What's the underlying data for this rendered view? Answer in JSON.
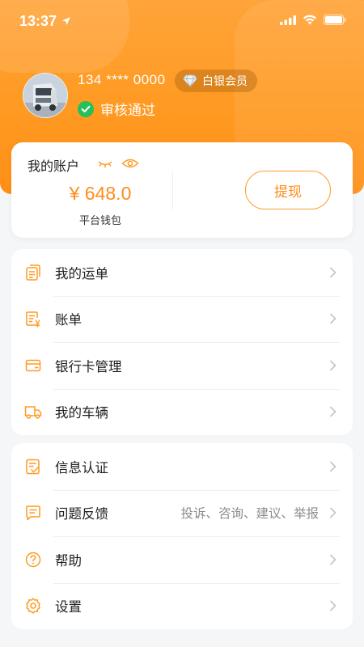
{
  "colors": {
    "brand": "#FF9A22",
    "amount": "#FF8C1A",
    "verified": "#25C05A",
    "page_background": "#F5F6F8"
  },
  "status_bar": {
    "time": "13:37",
    "icons": [
      "location-arrow-icon",
      "signal-icon",
      "wifi-icon",
      "battery-icon"
    ]
  },
  "profile": {
    "avatar_icon": "truck-photo",
    "phone": "134 **** 0000",
    "member_level": "白银会员",
    "member_icon": "diamond-icon",
    "verify_status": "审核通过",
    "verify_icon": "check-circle-icon"
  },
  "account": {
    "title": "我的账户",
    "visibility_icons": [
      "eye-closed-icon",
      "eye-open-icon"
    ],
    "balance": "¥ 648.0",
    "wallet_label": "平台钱包",
    "withdraw_label": "提现"
  },
  "menu_group_1": [
    {
      "label": "我的运单",
      "icon": "waybill-icon"
    },
    {
      "label": "账单",
      "icon": "bill-icon"
    },
    {
      "label": "银行卡管理",
      "icon": "bank-card-icon"
    },
    {
      "label": "我的车辆",
      "icon": "truck-icon"
    }
  ],
  "menu_group_2": [
    {
      "label": "信息认证",
      "icon": "certification-icon",
      "hint": ""
    },
    {
      "label": "问题反馈",
      "icon": "feedback-icon",
      "hint": "投诉、咨询、建议、举报"
    },
    {
      "label": "帮助",
      "icon": "help-icon",
      "hint": ""
    },
    {
      "label": "设置",
      "icon": "settings-icon",
      "hint": ""
    }
  ]
}
